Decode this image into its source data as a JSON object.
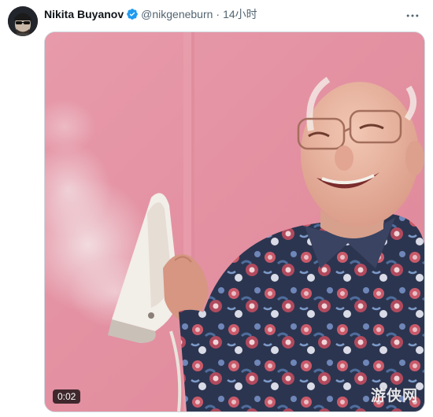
{
  "tweet": {
    "author": {
      "display_name": "Nikita Buyanov",
      "handle": "@nikgeneburn",
      "verified_icon": "verified-badge-icon"
    },
    "separator": "·",
    "time": "14小时",
    "more_icon": "more-horizontal-icon",
    "media": {
      "type": "video",
      "duration": "0:02",
      "watermark": "游侠网"
    }
  },
  "colors": {
    "verified_blue": "#1d9bf0",
    "secondary_text": "#536471",
    "primary_text": "#0f1419",
    "video_background": "#e58da0"
  }
}
